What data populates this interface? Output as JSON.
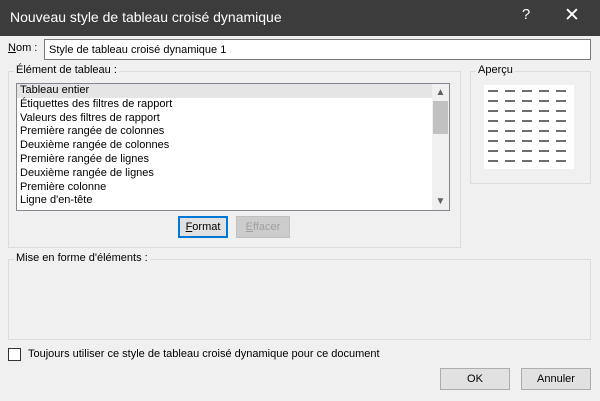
{
  "dialog": {
    "title": "Nouveau style de tableau croisé dynamique",
    "help_label": "?",
    "close_label": "✕"
  },
  "name": {
    "label": "Nom :",
    "value": "Style de tableau croisé dynamique 1"
  },
  "elements": {
    "label": "Élément de tableau :",
    "items": [
      "Tableau entier",
      "Étiquettes des filtres de rapport",
      "Valeurs des filtres de rapport",
      "Première rangée de colonnes",
      "Deuxième rangée de colonnes",
      "Première rangée de lignes",
      "Deuxième rangée de lignes",
      "Première colonne",
      "Ligne d'en-tête"
    ],
    "selected_index": 0,
    "scroll_up": "▲",
    "scroll_down": "▼"
  },
  "buttons": {
    "format_label": "Format",
    "clear_label": "Effacer",
    "ok_label": "OK",
    "cancel_label": "Annuler"
  },
  "preview": {
    "label": "Aperçu"
  },
  "formatting": {
    "label": "Mise en forme d'éléments :"
  },
  "default_option": {
    "label": "Toujours utiliser ce style de tableau croisé dynamique pour ce document",
    "checked": false
  }
}
